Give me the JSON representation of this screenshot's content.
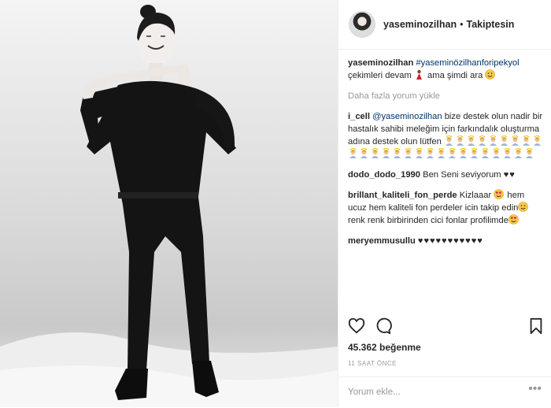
{
  "post": {
    "username": "yaseminozilhan",
    "separator": "•",
    "follow_status": "Takiptesin",
    "caption": {
      "username": "yaseminozilhan",
      "hashtag": "#yaseminözilhanforipekyol",
      "text_line": "çekimleri devam",
      "text_tail": "ama şimdi ara"
    },
    "load_more": "Daha fazla yorum yükle",
    "comments": [
      {
        "username": "i_cell",
        "mention": "@yaseminozilhan",
        "text": "bize destek olun nadir bir hastalık sahibi meleğim için farkındalık oluşturma adına destek olun lütfen"
      },
      {
        "username": "dodo_dodo_1990",
        "text": "Ben Seni seviyorum"
      },
      {
        "username": "brillant_kaliteli_fon_perde",
        "text": "Kizlaaar",
        "text2": "hem ucuz hem kaliteli fon perdeler icin takip edin",
        "text3": "renk renk birbirinden cici fonlar profilimde"
      },
      {
        "username": "meryemmusullu"
      }
    ],
    "likes": "45.362 beğenme",
    "time": "11 SAAT ÖNCE",
    "add_comment_placeholder": "Yorum ekle...",
    "more_options": "•••"
  },
  "icons": [
    "heart-icon",
    "comment-icon",
    "bookmark-icon",
    "emoji-icon"
  ]
}
